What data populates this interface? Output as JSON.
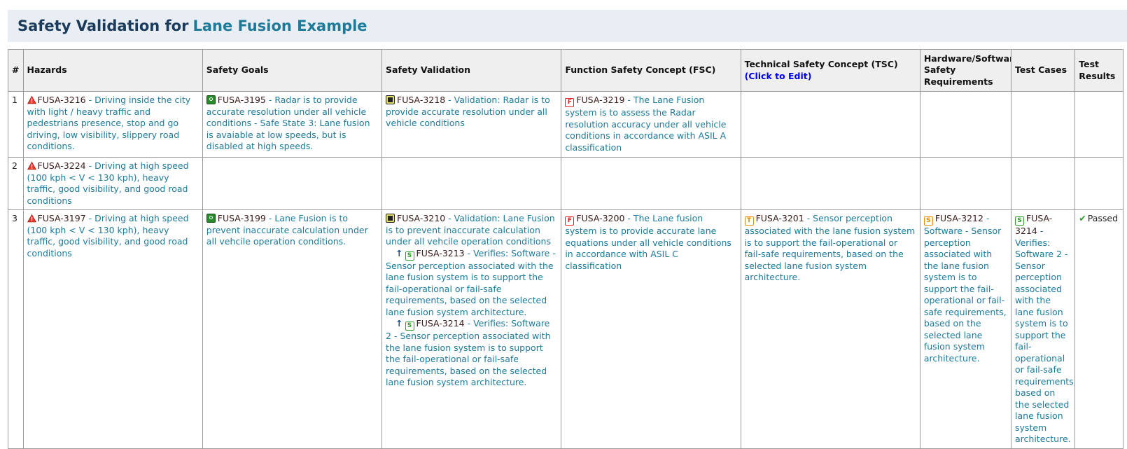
{
  "header": {
    "title": "Safety Validation for",
    "project": "Lane Fusion Example"
  },
  "columns": {
    "num": "#",
    "hazards": "Hazards",
    "goals": "Safety Goals",
    "validation": "Safety Validation",
    "fsc": "Function Safety Concept (FSC)",
    "tsc": "Technical Safety Concept (TSC)",
    "tsc_edit": "(Click to Edit)",
    "hwsw": "Hardware/Software Safety Requirements",
    "tests": "Test Cases",
    "results": "Test Results"
  },
  "rows": [
    {
      "num": "1",
      "hazard": {
        "id": "FUSA-3216",
        "text": " - Driving inside the city with light / heavy traffic and pedestrians presence, stop and go driving, low visibility, slippery road conditions."
      },
      "goal": {
        "id": "FUSA-3195",
        "text": " - Radar is to provide accurate resolution under all vehicle conditions - Safe State 3: Lane fusion is avaiable at low speeds, but is disabled at high speeds."
      },
      "validation": {
        "id": "FUSA-3218",
        "text": " - Validation: Radar is to provide accurate resolution under all vehicle conditions"
      },
      "fsc": {
        "id": "FUSA-3219",
        "text": " - The Lane Fusion system is to assess the Radar resolution accuracy under all vehicle conditions in accordance with ASIL A classification"
      }
    },
    {
      "num": "2",
      "hazard": {
        "id": "FUSA-3224",
        "text": " - Driving at high speed (100 kph < V < 130 kph), heavy traffic, good visibility, and good road conditions"
      }
    },
    {
      "num": "3",
      "hazard": {
        "id": "FUSA-3197",
        "text": " - Driving at high speed (100 kph < V < 130 kph), heavy traffic, good visibility, and good road conditions"
      },
      "goal": {
        "id": "FUSA-3199",
        "text": " - Lane Fusion is to prevent inaccurate calculation under all vehcile operation conditions."
      },
      "validation": {
        "id": "FUSA-3210",
        "text": " - Validation: Lane Fusion is to prevent inaccurate calculation under all vehcile operation conditions"
      },
      "verifies": [
        {
          "id": "FUSA-3213",
          "text": " - Verifies: Software - Sensor perception associated with the lane fusion system is to support the fail-operational or fail-safe requirements, based on the selected lane fusion system architecture."
        },
        {
          "id": "FUSA-3214",
          "text": " - Verifies: Software 2 - Sensor perception associated with the lane fusion system is to support the fail-operational or fail-safe requirements, based on the selected lane fusion system architecture."
        }
      ],
      "fsc": {
        "id": "FUSA-3200",
        "text": " - The Lane fusion system is to provide accurate lane equations under all vehicle conditions in accordance with ASIL C classification"
      },
      "tsc": {
        "id": "FUSA-3201",
        "text": " - Sensor perception associated with the lane fusion system is to support the fail-operational or fail-safe requirements, based on the selected lane fusion system architecture."
      },
      "hwsw": {
        "id": "FUSA-3212",
        "text": " - Software - Sensor perception associated with the lane fusion system is to support the fail-operational or fail-safe requirements, based on the selected lane fusion system architecture."
      },
      "test": {
        "id": "FUSA-3214",
        "text": " - Verifies: Software 2 - Sensor perception associated with the lane fusion system is to support the fail-operational or fail-safe requirements, based on the selected lane fusion system architecture."
      },
      "result": "Passed"
    }
  ],
  "icons": {
    "hazard": "warning-triangle-icon",
    "goal": "safety-goal-icon",
    "validation": "validation-icon",
    "fsc": "F-badge-icon",
    "tsc": "T-badge-icon",
    "software": "S-badge-icon",
    "trace": "up-arrow-icon",
    "pass": "checkmark-icon"
  },
  "colors": {
    "link": "#1d7a9a",
    "title": "#1b3b5c",
    "header_bg": "#e8eef3",
    "passed": "#2a9a2a"
  }
}
